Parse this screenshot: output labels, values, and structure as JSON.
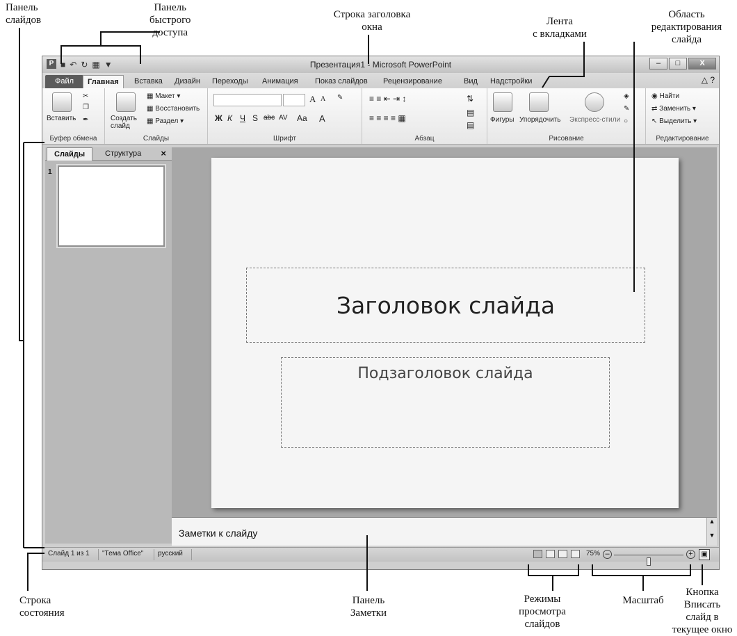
{
  "callouts": {
    "slides_panel": "Панель\nслайдов",
    "qat": "Панель\nбыстрого\nдоступа",
    "title_bar": "Строка заголовка\nокна",
    "ribbon": "Лента\nс вкладками",
    "edit_area": "Область\nредактирования\nслайда",
    "status_bar": "Строка\nсостояния",
    "notes_panel": "Панель\nЗаметки",
    "view_modes": "Режимы\nпросмотра\nслайдов",
    "zoom": "Масштаб",
    "fit_button": "Кнопка\nВписать\nслайд в\nтекущее окно"
  },
  "window": {
    "title": "Презентация1 - Microsoft PowerPoint",
    "app_icon": "P",
    "qat_icons": [
      "save-icon",
      "undo-icon",
      "redo-icon",
      "new-slide-icon",
      "customize-qat-icon"
    ]
  },
  "tabs": [
    "Файл",
    "Главная",
    "Вставка",
    "Дизайн",
    "Переходы",
    "Анимация",
    "Показ слайдов",
    "Рецензирование",
    "Вид",
    "Надстройки"
  ],
  "active_tab": "Главная",
  "ribbon": {
    "clipboard": {
      "paste": "Вставить",
      "label": "Буфер обмена"
    },
    "slides": {
      "create": "Создать слайд",
      "layout": "Макет",
      "reset": "Восстановить",
      "section": "Раздел",
      "label": "Слайды"
    },
    "font": {
      "bold": "Ж",
      "italic": "К",
      "underline": "Ч",
      "shadow": "S",
      "strike": "abc",
      "spacing": "AV",
      "case": "Aa",
      "color": "A",
      "grow": "A",
      "shrink": "A",
      "label": "Шрифт"
    },
    "paragraph": {
      "label": "Абзац"
    },
    "drawing": {
      "shapes": "Фигуры",
      "arrange": "Упорядочить",
      "styles": "Экспресс-стили",
      "label": "Рисование"
    },
    "editing": {
      "find": "Найти",
      "replace": "Заменить",
      "select": "Выделить",
      "label": "Редактирование"
    }
  },
  "slides_panel": {
    "tabs": [
      "Слайды",
      "Структура"
    ],
    "close": "×",
    "slide_number": "1"
  },
  "slide": {
    "title": "Заголовок слайда",
    "subtitle": "Подзаголовок слайда"
  },
  "notes": {
    "text": "Заметки к слайду"
  },
  "status": {
    "slide": "Слайд 1 из 1",
    "theme": "\"Тема Office\"",
    "language": "русский",
    "zoom": "75%",
    "zoom_level": 0.5
  }
}
